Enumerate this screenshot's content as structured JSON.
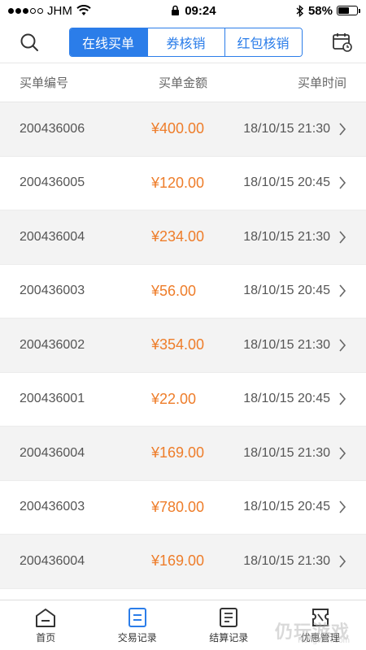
{
  "status": {
    "carrier": "JHM",
    "time": "09:24",
    "battery": "58%",
    "battery_level": 0.58
  },
  "nav": {
    "tabs": [
      "在线买单",
      "券核销",
      "红包核销"
    ],
    "active_tab": 0
  },
  "columns": {
    "order_no": "买单编号",
    "amount": "买单金额",
    "time": "买单时间"
  },
  "rows": [
    {
      "order": "200436006",
      "amount": "¥400.00",
      "time": "18/10/15 21:30"
    },
    {
      "order": "200436005",
      "amount": "¥120.00",
      "time": "18/10/15 20:45"
    },
    {
      "order": "200436004",
      "amount": "¥234.00",
      "time": "18/10/15 21:30"
    },
    {
      "order": "200436003",
      "amount": "¥56.00",
      "time": "18/10/15 20:45"
    },
    {
      "order": "200436002",
      "amount": "¥354.00",
      "time": "18/10/15 21:30"
    },
    {
      "order": "200436001",
      "amount": "¥22.00",
      "time": "18/10/15 20:45"
    },
    {
      "order": "200436004",
      "amount": "¥169.00",
      "time": "18/10/15 21:30"
    },
    {
      "order": "200436003",
      "amount": "¥780.00",
      "time": "18/10/15 20:45"
    },
    {
      "order": "200436004",
      "amount": "¥169.00",
      "time": "18/10/15 21:30"
    }
  ],
  "tabbar": {
    "items": [
      {
        "label": "首页",
        "icon": "home-icon"
      },
      {
        "label": "交易记录",
        "icon": "transaction-records-icon"
      },
      {
        "label": "结算记录",
        "icon": "settlement-records-icon"
      },
      {
        "label": "优惠管理",
        "icon": "discount-management-icon"
      }
    ],
    "active": 1
  },
  "watermark": {
    "text": "仍玩游戏",
    "sub": "Rengwan.com"
  },
  "colors": {
    "accent": "#2b7de9",
    "amount": "#ee7d2a",
    "row_shade": "#f3f3f3"
  }
}
